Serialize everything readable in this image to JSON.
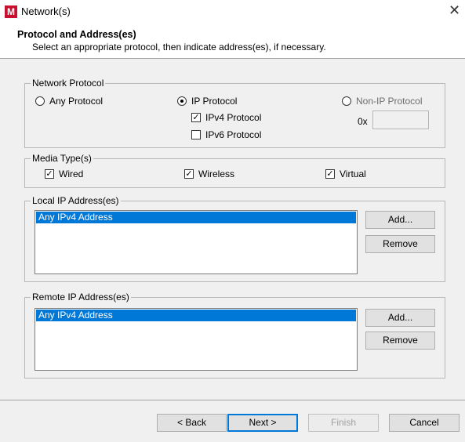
{
  "window": {
    "title": "Network(s)",
    "icon_letter": "M",
    "close_glyph": "✕"
  },
  "header": {
    "title": "Protocol and Address(es)",
    "subtitle": "Select an appropriate protocol, then indicate address(es), if necessary."
  },
  "network_protocol": {
    "legend": "Network Protocol",
    "any": "Any Protocol",
    "ip": "IP Protocol",
    "non_ip": "Non-IP Protocol",
    "ipv4": "IPv4 Protocol",
    "ipv6": "IPv6 Protocol",
    "hex_prefix": "0x",
    "hex_value": "",
    "selected": "IP Protocol",
    "ipv4_checked": true,
    "ipv6_checked": false
  },
  "media_types": {
    "legend": "Media Type(s)",
    "wired": "Wired",
    "wireless": "Wireless",
    "virtual": "Virtual",
    "wired_checked": true,
    "wireless_checked": true,
    "virtual_checked": true
  },
  "local_ip": {
    "legend": "Local IP Address(es)",
    "items": [
      "Any IPv4 Address"
    ],
    "add": "Add...",
    "remove": "Remove"
  },
  "remote_ip": {
    "legend": "Remote IP Address(es)",
    "items": [
      "Any IPv4 Address"
    ],
    "add": "Add...",
    "remove": "Remove"
  },
  "footer": {
    "back": "< Back",
    "next": "Next >",
    "finish": "Finish",
    "cancel": "Cancel"
  },
  "colors": {
    "selection": "#0078d7",
    "brand": "#c8102e"
  }
}
